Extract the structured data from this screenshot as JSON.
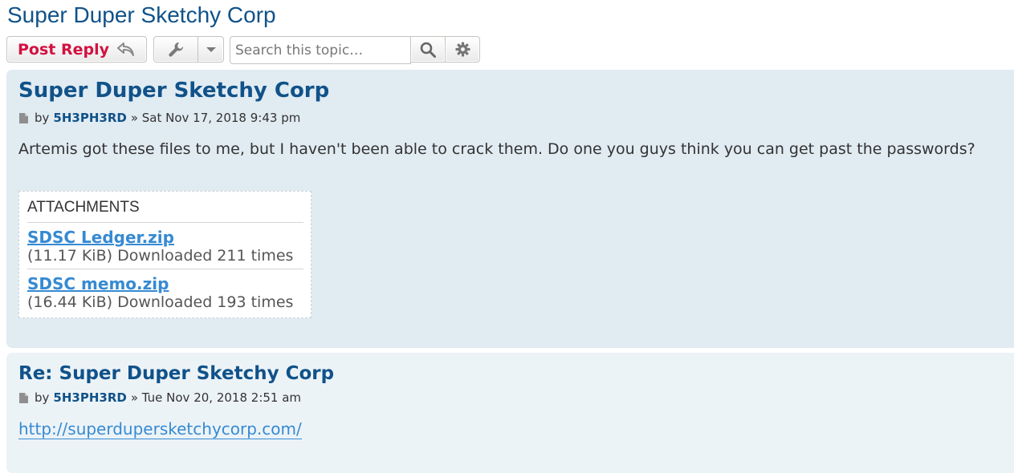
{
  "page_title": "Super Duper Sketchy Corp",
  "toolbar": {
    "post_reply_label": "Post Reply",
    "search_placeholder": "Search this topic…"
  },
  "posts": [
    {
      "title": "Super Duper Sketchy Corp",
      "by_label": "by",
      "author": "5H3PH3RD",
      "date": "» Sat Nov 17, 2018 9:43 pm",
      "content": "Artemis got these files to me, but I haven't been able to crack them. Do one you guys think you can get past the passwords?",
      "attachments": {
        "heading": "ATTACHMENTS",
        "files": [
          {
            "name": "SDSC Ledger.zip",
            "info": "(11.17 KiB) Downloaded 211 times"
          },
          {
            "name": "SDSC memo.zip",
            "info": "(16.44 KiB) Downloaded 193 times"
          }
        ]
      }
    },
    {
      "title": "Re: Super Duper Sketchy Corp",
      "by_label": "by",
      "author": "5H3PH3RD",
      "date": "» Tue Nov 20, 2018 2:51 am",
      "link": "http://superdupersketchycorp.com/"
    }
  ],
  "icons": {
    "reply": "reply-arrow-icon",
    "tools": "wrench-icon",
    "dropdown": "caret-down-icon",
    "search": "search-icon",
    "advanced": "gear-icon",
    "post": "post-page-icon"
  },
  "colors": {
    "title_blue": "#105289",
    "reply_red": "#d31141",
    "link_blue": "#368ad2",
    "post_bg_1": "#e1ebf2",
    "post_bg_2": "#ecf3f7"
  }
}
